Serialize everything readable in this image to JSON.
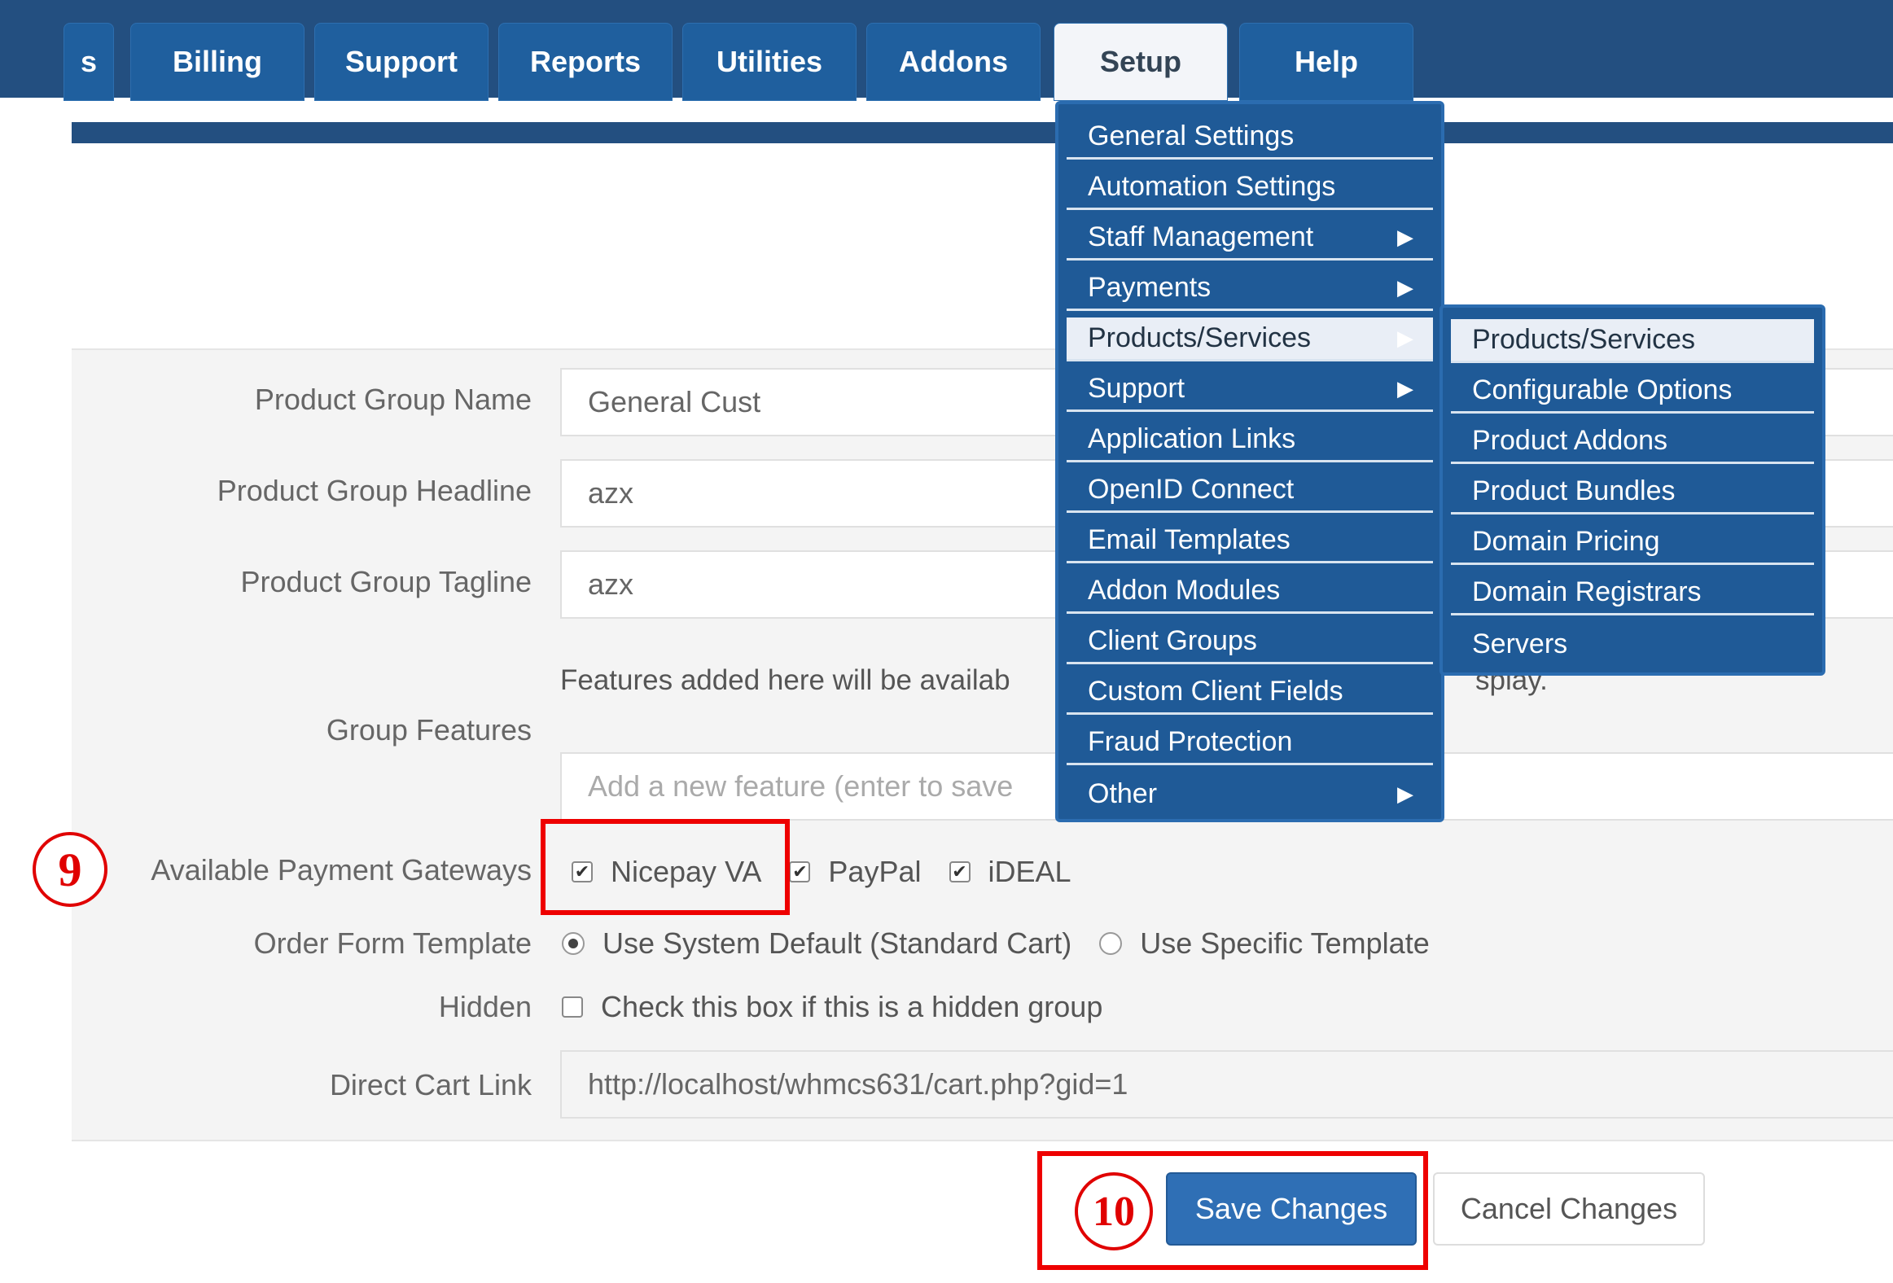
{
  "tabs": [
    {
      "label": "s"
    },
    {
      "label": "Billing"
    },
    {
      "label": "Support"
    },
    {
      "label": "Reports"
    },
    {
      "label": "Utilities"
    },
    {
      "label": "Addons"
    },
    {
      "label": "Setup"
    },
    {
      "label": "Help"
    }
  ],
  "setup_menu": [
    {
      "label": "General Settings"
    },
    {
      "label": "Automation Settings"
    },
    {
      "label": "Staff Management",
      "arrow": "▶"
    },
    {
      "label": "Payments",
      "arrow": "▶"
    },
    {
      "label": "Products/Services",
      "arrow": "▶"
    },
    {
      "label": "Support",
      "arrow": "▶"
    },
    {
      "label": "Application Links"
    },
    {
      "label": "OpenID Connect"
    },
    {
      "label": "Email Templates"
    },
    {
      "label": "Addon Modules"
    },
    {
      "label": "Client Groups"
    },
    {
      "label": "Custom Client Fields"
    },
    {
      "label": "Fraud Protection"
    },
    {
      "label": "Other",
      "arrow": "▶"
    }
  ],
  "products_submenu": [
    {
      "label": "Products/Services"
    },
    {
      "label": "Configurable Options"
    },
    {
      "label": "Product Addons"
    },
    {
      "label": "Product Bundles"
    },
    {
      "label": "Domain Pricing"
    },
    {
      "label": "Domain Registrars"
    },
    {
      "label": "Servers"
    }
  ],
  "form": {
    "group_name_label": "Product Group Name",
    "group_name_value": "General Cust",
    "headline_label": "Product Group Headline",
    "headline_value": "azx",
    "tagline_label": "Product Group Tagline",
    "tagline_value": "azx",
    "features_label": "Group Features",
    "features_hint_left": "Features added here will be availab",
    "features_hint_right": "splay.",
    "features_placeholder": "Add a new feature (enter to save",
    "gateways_label": "Available Payment Gateways",
    "gateways": [
      {
        "label": "Nicepay VA",
        "checked": true
      },
      {
        "label": "PayPal",
        "checked": true
      },
      {
        "label": "iDEAL",
        "checked": true
      }
    ],
    "template_label": "Order Form Template",
    "template_default": "Use System Default (Standard Cart)",
    "template_specific": "Use Specific Template",
    "hidden_label": "Hidden",
    "hidden_text": "Check this box if this is a hidden group",
    "cart_link_label": "Direct Cart Link",
    "cart_link_value": "http://localhost/whmcs631/cart.php?gid=1"
  },
  "buttons": {
    "save": "Save Changes",
    "cancel": "Cancel Changes"
  },
  "annotations": {
    "step9": "9",
    "step10": "10"
  },
  "colors": {
    "nav": "#234f80",
    "tab": "#1f5f9e",
    "menu": "#1f5a97",
    "annotation": "#ee0000"
  }
}
